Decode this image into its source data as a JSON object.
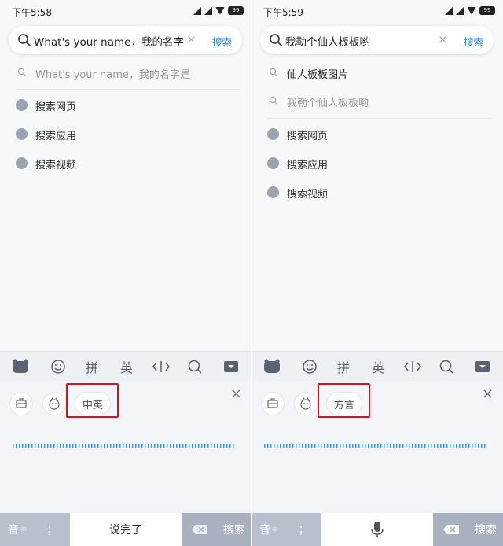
{
  "left": {
    "status": {
      "time": "下午5:58",
      "battery": "99"
    },
    "search": {
      "query": "What's your name，我的名字是",
      "clear": "×",
      "button": "搜索"
    },
    "suggestions": [
      {
        "text": "What's your name，我的名字是"
      }
    ],
    "actions": [
      {
        "label": "搜索网页"
      },
      {
        "label": "搜索应用"
      },
      {
        "label": "搜索视频"
      }
    ],
    "toolbar": {
      "pinyin": "拼",
      "english": "英"
    },
    "voice": {
      "mode_chip": "中英",
      "close": "×"
    },
    "keys": {
      "yin": "音",
      "yin_sub": "中",
      "semicolon": "；",
      "done": "说完了",
      "search": "搜索"
    }
  },
  "right": {
    "status": {
      "time": "下午5:59",
      "battery": "99"
    },
    "search": {
      "query": "我勒个仙人板板哟",
      "clear": "×",
      "button": "搜索"
    },
    "suggestions": [
      {
        "text": "仙人板板图片"
      },
      {
        "text": "我勒个仙人板板哟"
      }
    ],
    "actions": [
      {
        "label": "搜索网页"
      },
      {
        "label": "搜索应用"
      },
      {
        "label": "搜索视频"
      }
    ],
    "toolbar": {
      "pinyin": "拼",
      "english": "英"
    },
    "voice": {
      "mode_chip": "方言",
      "close": "×"
    },
    "keys": {
      "yin": "音",
      "yin_sub": "中",
      "semicolon": "；",
      "search": "搜索"
    }
  },
  "colors": {
    "accent": "#2b8de3",
    "highlight_box": "#d9131b",
    "wave": "#2e8ae6"
  }
}
